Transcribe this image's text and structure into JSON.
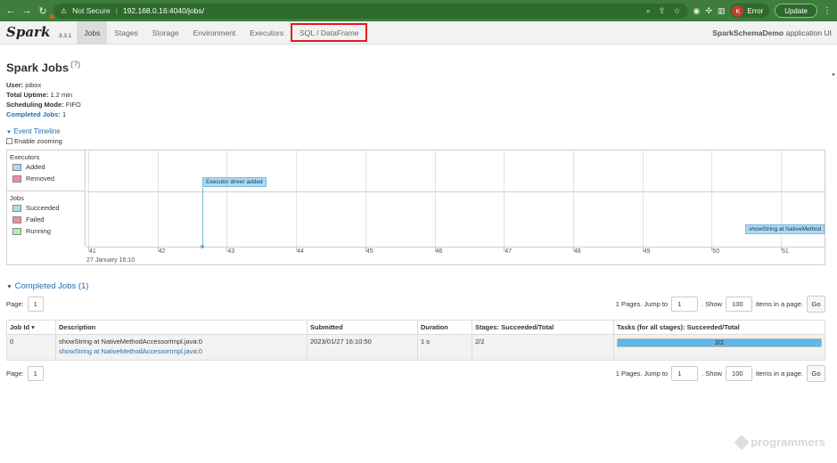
{
  "browser": {
    "security": "Not Secure",
    "url": "192.168.0.16:4040/jobs/",
    "profile_initial": "K",
    "error_label": "Error",
    "update_label": "Update"
  },
  "navbar": {
    "version": "3.3.1",
    "tabs": [
      "Jobs",
      "Stages",
      "Storage",
      "Environment",
      "Executors",
      "SQL / DataFrame"
    ],
    "active_tab": "Jobs",
    "highlighted_tab": "SQL / DataFrame",
    "app_name": "SparkSchemaDemo",
    "app_suffix": "application UI"
  },
  "page": {
    "title": "Spark Jobs",
    "help": "(?)",
    "user_label": "User:",
    "user": "jobox",
    "uptime_label": "Total Uptime:",
    "uptime": "1.2 min",
    "scheduling_label": "Scheduling Mode:",
    "scheduling": "FIFO",
    "completed_label": "Completed Jobs:",
    "completed": "1"
  },
  "timeline": {
    "toggle": "Event Timeline",
    "zoom_label": "Enable zooming",
    "executors_header": "Executors",
    "executors_legend": [
      "Added",
      "Removed"
    ],
    "jobs_header": "Jobs",
    "jobs_legend": [
      "Succeeded",
      "Failed",
      "Running"
    ],
    "ticks": [
      "41",
      "42",
      "43",
      "44",
      "45",
      "46",
      "47",
      "48",
      "49",
      "50",
      "51"
    ],
    "date_label": "27 January 16:10",
    "executor_event": "Executor driver added",
    "job_event": "showString at NativeMethod"
  },
  "completed_jobs": {
    "header": "Completed Jobs (1)",
    "page_label": "Page:",
    "page_value": "1",
    "pages_text": "1 Pages. Jump to",
    "jump_value": "1",
    "show_label": ". Show",
    "show_value": "100",
    "items_label": "items in a page.",
    "go_label": "Go",
    "columns": [
      "Job Id ▾",
      "Description",
      "Submitted",
      "Duration",
      "Stages: Succeeded/Total",
      "Tasks (for all stages): Succeeded/Total"
    ],
    "rows": [
      {
        "job_id": "0",
        "description": "showString at NativeMethodAccessorImpl.java:0",
        "description_link": "showString at NativeMethodAccessorImpl.java:0",
        "submitted": "2023/01/27 16:10:50",
        "duration": "1 s",
        "stages": "2/2",
        "tasks": "2/2",
        "tasks_fraction": 1.0
      }
    ]
  },
  "colors": {
    "added": "#a8dcf5",
    "removed": "#f38ba0",
    "succeeded": "#a8dcf5",
    "failed": "#f38ba0",
    "running": "#a6f5b0"
  },
  "watermark": "programmers"
}
